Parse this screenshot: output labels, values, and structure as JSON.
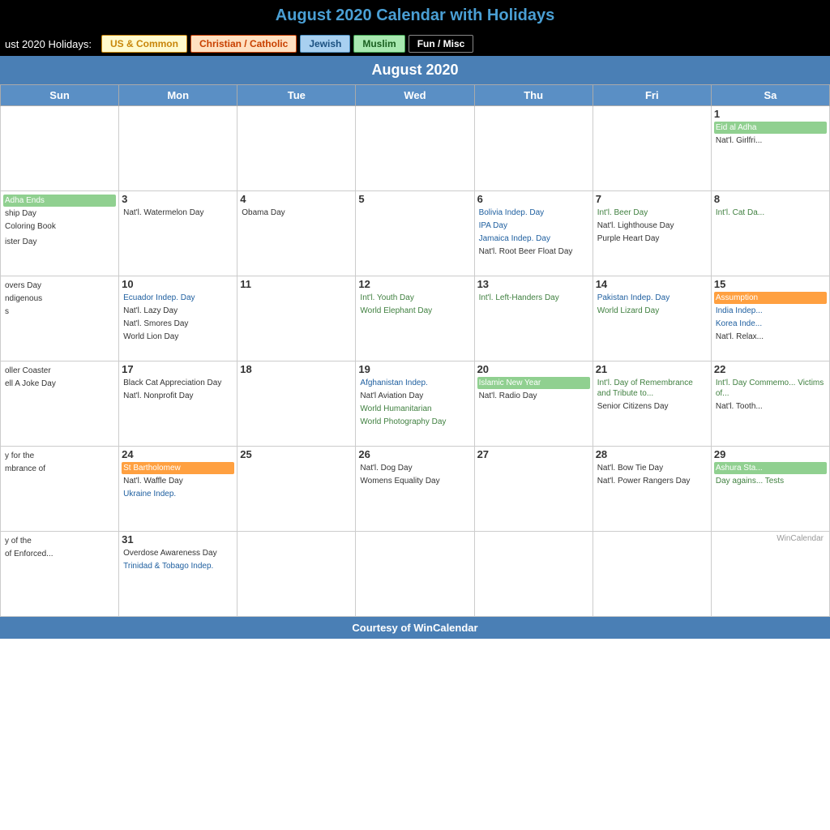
{
  "title": "August 2020 Calendar with Holidays",
  "holidays_label": "ust 2020 Holidays:",
  "tabs": [
    {
      "label": "US & Common",
      "class": "tab-us"
    },
    {
      "label": "Christian / Catholic",
      "class": "tab-christian"
    },
    {
      "label": "Jewish",
      "class": "tab-jewish"
    },
    {
      "label": "Muslim",
      "class": "tab-muslim"
    },
    {
      "label": "Fun / Misc",
      "class": "tab-fun"
    }
  ],
  "month_title": "August 2020",
  "days_of_week": [
    "Sun",
    "Mon",
    "Tue",
    "Wed",
    "Thu",
    "Fri",
    "Sa"
  ],
  "footer": "Courtesy of WinCalendar",
  "watermark": "WinCalendar"
}
